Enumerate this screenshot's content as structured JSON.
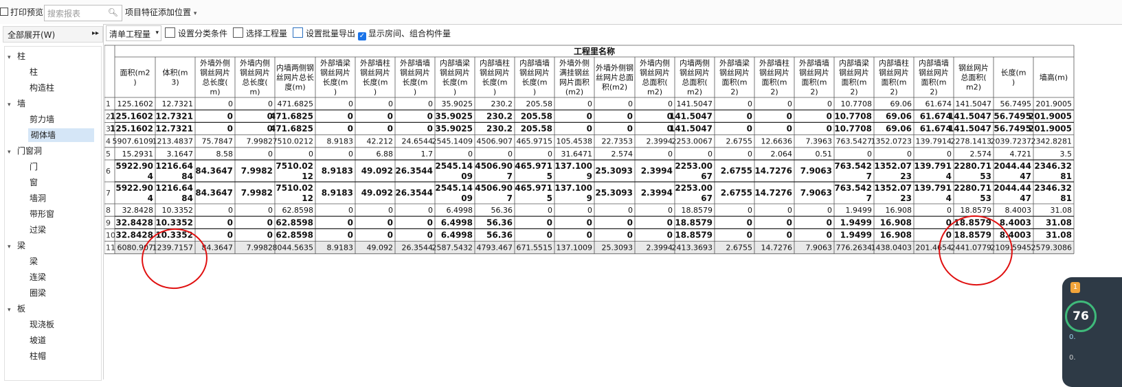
{
  "toolbar": {
    "print_preview": "打印预览",
    "search_placeholder": "搜索报表",
    "feature_position": "项目特征添加位置"
  },
  "sidebar": {
    "expand_all": "全部展开(W)",
    "tree": [
      {
        "label": "柱",
        "level": 0
      },
      {
        "label": "柱",
        "level": 1
      },
      {
        "label": "构造柱",
        "level": 1
      },
      {
        "label": "墙",
        "level": 0
      },
      {
        "label": "剪力墙",
        "level": 1
      },
      {
        "label": "砌体墙",
        "level": 1,
        "selected": true
      },
      {
        "label": "门窗洞",
        "level": 0
      },
      {
        "label": "门",
        "level": 1
      },
      {
        "label": "窗",
        "level": 1
      },
      {
        "label": "墙洞",
        "level": 1
      },
      {
        "label": "带形窗",
        "level": 1
      },
      {
        "label": "过梁",
        "level": 1
      },
      {
        "label": "梁",
        "level": 0
      },
      {
        "label": "梁",
        "level": 1
      },
      {
        "label": "连梁",
        "level": 1
      },
      {
        "label": "圈梁",
        "level": 1
      },
      {
        "label": "板",
        "level": 0
      },
      {
        "label": "现浇板",
        "level": 1
      },
      {
        "label": "坡道",
        "level": 1
      },
      {
        "label": "柱帽",
        "level": 1
      }
    ]
  },
  "subtoolbar": {
    "list_select": "清单工程量",
    "set_category": "设置分类条件",
    "select_qty": "选择工程量",
    "batch_export": "设置批量导出",
    "show_rooms": "显示房间、组合构件量",
    "show_rooms_checked": true
  },
  "grid": {
    "group_header": "工程里名称",
    "headers": [
      "面积(m2)",
      "体积(m3)",
      "外墙外侧钢丝网片总长度(m)",
      "外墙内侧钢丝网片总长度(m)",
      "内墙两侧钢丝网片总长度(m)",
      "外部墙梁钢丝网片长度(m)",
      "外部墙柱钢丝网片长度(m)",
      "外部墙墙钢丝网片长度(m)",
      "内部墙梁钢丝网片长度(m)",
      "内部墙柱钢丝网片长度(m)",
      "内部墙墙钢丝网片长度(m)",
      "外墙外侧满挂钢丝网片面积(m2)",
      "外墙外侧钢丝网片总面积(m2)",
      "外墙内侧钢丝网片总面积(m2)",
      "内墙两侧钢丝网片总面积(m2)",
      "外部墙梁钢丝网片面积(m2)",
      "外部墙柱钢丝网片面积(m2)",
      "外部墙墙钢丝网片面积(m2)",
      "内部墙梁钢丝网片面积(m2)",
      "内部墙柱钢丝网片面积(m2)",
      "内部墙墙钢丝网片面积(m2)",
      "钢丝网片总面积(m2)",
      "长度(m)",
      "墙高(m)"
    ],
    "rows": [
      {
        "n": "1",
        "bold": false,
        "cells": [
          "125.1602",
          "12.7321",
          "0",
          "0",
          "471.6825",
          "0",
          "0",
          "0",
          "35.9025",
          "230.2",
          "205.58",
          "0",
          "0",
          "0",
          "141.5047",
          "0",
          "0",
          "0",
          "10.7708",
          "69.06",
          "61.674",
          "141.5047",
          "56.7495",
          "201.9005"
        ]
      },
      {
        "n": "2",
        "bold": true,
        "cells": [
          "125.1602",
          "12.7321",
          "0",
          "0",
          "471.6825",
          "0",
          "0",
          "0",
          "35.9025",
          "230.2",
          "205.58",
          "0",
          "0",
          "0",
          "141.5047",
          "0",
          "0",
          "0",
          "10.7708",
          "69.06",
          "61.674",
          "141.5047",
          "56.7495",
          "201.9005"
        ]
      },
      {
        "n": "3",
        "bold": true,
        "cells": [
          "125.1602",
          "12.7321",
          "0",
          "0",
          "471.6825",
          "0",
          "0",
          "0",
          "35.9025",
          "230.2",
          "205.58",
          "0",
          "0",
          "0",
          "141.5047",
          "0",
          "0",
          "0",
          "10.7708",
          "69.06",
          "61.674",
          "141.5047",
          "56.7495",
          "201.9005"
        ]
      },
      {
        "n": "4",
        "bold": false,
        "cells": [
          "5907.6109",
          "1213.4837",
          "75.7847",
          "7.9982",
          "7510.0212",
          "8.9183",
          "42.212",
          "24.6544",
          "2545.1409",
          "4506.907",
          "465.9715",
          "105.4538",
          "22.7353",
          "2.3994",
          "2253.0067",
          "2.6755",
          "12.6636",
          "7.3963",
          "763.5427",
          "1352.0723",
          "139.7914",
          "2278.1413",
          "2039.7237",
          "2342.8281"
        ]
      },
      {
        "n": "5",
        "bold": false,
        "cells": [
          "15.2931",
          "3.1647",
          "8.58",
          "0",
          "0",
          "0",
          "6.88",
          "1.7",
          "0",
          "0",
          "0",
          "31.6471",
          "2.574",
          "0",
          "0",
          "0",
          "2.064",
          "0.51",
          "0",
          "0",
          "0",
          "2.574",
          "4.721",
          "3.5"
        ]
      },
      {
        "n": "6",
        "bold": true,
        "tall": true,
        "cells": [
          "5922.904",
          "1216.6484",
          "84.3647",
          "7.9982",
          "7510.0212",
          "8.9183",
          "49.092",
          "26.3544",
          "2545.1409",
          "4506.907",
          "465.9715",
          "137.1009",
          "25.3093",
          "2.3994",
          "2253.0067",
          "2.6755",
          "14.7276",
          "7.9063",
          "763.5427",
          "1352.0723",
          "139.7914",
          "2280.7153",
          "2044.4447",
          "2346.3281"
        ]
      },
      {
        "n": "7",
        "bold": true,
        "tall": true,
        "cells": [
          "5922.904",
          "1216.6484",
          "84.3647",
          "7.9982",
          "7510.0212",
          "8.9183",
          "49.092",
          "26.3544",
          "2545.1409",
          "4506.907",
          "465.9715",
          "137.1009",
          "25.3093",
          "2.3994",
          "2253.0067",
          "2.6755",
          "14.7276",
          "7.9063",
          "763.5427",
          "1352.0723",
          "139.7914",
          "2280.7153",
          "2044.4447",
          "2346.3281"
        ]
      },
      {
        "n": "8",
        "bold": false,
        "cells": [
          "32.8428",
          "10.3352",
          "0",
          "0",
          "62.8598",
          "0",
          "0",
          "0",
          "6.4998",
          "56.36",
          "0",
          "0",
          "0",
          "0",
          "18.8579",
          "0",
          "0",
          "0",
          "1.9499",
          "16.908",
          "0",
          "18.8579",
          "8.4003",
          "31.08"
        ]
      },
      {
        "n": "9",
        "bold": true,
        "cells": [
          "32.8428",
          "10.3352",
          "0",
          "0",
          "62.8598",
          "0",
          "0",
          "0",
          "6.4998",
          "56.36",
          "0",
          "0",
          "0",
          "0",
          "18.8579",
          "0",
          "0",
          "0",
          "1.9499",
          "16.908",
          "0",
          "18.8579",
          "8.4003",
          "31.08"
        ]
      },
      {
        "n": "10",
        "bold": true,
        "cells": [
          "32.8428",
          "10.3352",
          "0",
          "0",
          "62.8598",
          "0",
          "0",
          "0",
          "6.4998",
          "56.36",
          "0",
          "0",
          "0",
          "0",
          "18.8579",
          "0",
          "0",
          "0",
          "1.9499",
          "16.908",
          "0",
          "18.8579",
          "8.4003",
          "31.08"
        ]
      },
      {
        "n": "11",
        "bold": false,
        "total": true,
        "cells": [
          "6080.907",
          "1239.7157",
          "84.3647",
          "7.9982",
          "8044.5635",
          "8.9183",
          "49.092",
          "26.3544",
          "2587.5432",
          "4793.467",
          "671.5515",
          "137.1009",
          "25.3093",
          "2.3994",
          "2413.3693",
          "2.6755",
          "14.7276",
          "7.9063",
          "776.2634",
          "1438.0403",
          "201.4654",
          "2441.0779",
          "2109.5945",
          "2579.3086"
        ]
      }
    ]
  },
  "widget": {
    "badge": "1",
    "score": "76",
    "line1": "0.",
    "line2": "0."
  }
}
